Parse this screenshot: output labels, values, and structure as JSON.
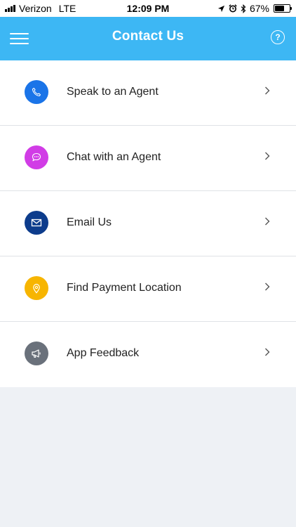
{
  "status_bar": {
    "carrier": "Verizon",
    "network": "LTE",
    "time": "12:09 PM",
    "battery_percent": "67%",
    "battery_level": 0.67
  },
  "header": {
    "title": "Contact Us",
    "help_glyph": "?",
    "background": "#3db7f4"
  },
  "menu": {
    "items": [
      {
        "label": "Speak to an Agent",
        "icon": "phone-icon",
        "color": "#1a74e8"
      },
      {
        "label": "Chat with an Agent",
        "icon": "chat-bubble-icon",
        "color": "#d13ce6"
      },
      {
        "label": "Email Us",
        "icon": "envelope-icon",
        "color": "#0d3c8c"
      },
      {
        "label": "Find Payment Location",
        "icon": "location-pin-icon",
        "color": "#f7b500"
      },
      {
        "label": "App Feedback",
        "icon": "megaphone-icon",
        "color": "#6a717b"
      }
    ]
  }
}
